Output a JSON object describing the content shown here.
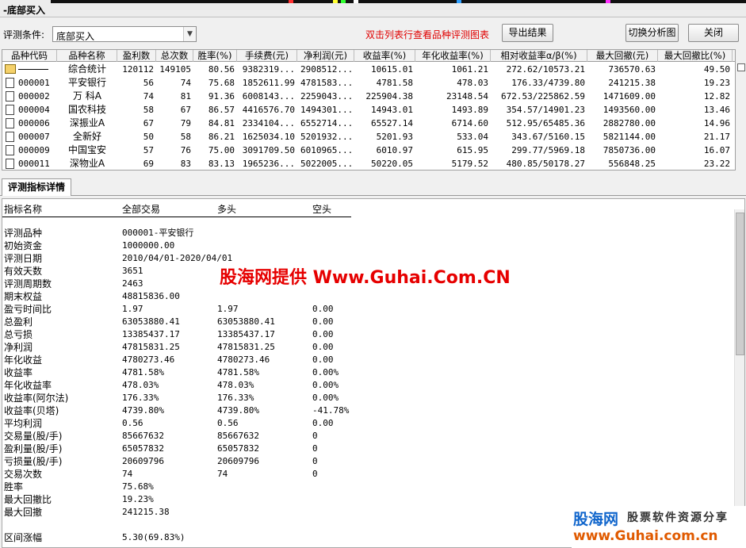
{
  "window": {
    "title": "-底部买入"
  },
  "condition": {
    "label": "评测条件:",
    "value": "底部买入",
    "hint": "双击列表行查看品种评测图表",
    "export_label": "导出结果",
    "switch_label": "切换分析图",
    "close_label": "关闭"
  },
  "table": {
    "columns": [
      "品种代码",
      "品种名称",
      "盈利数",
      "总次数",
      "胜率(%)",
      "手续费(元)",
      "净利润(元)",
      "收益率(%)",
      "年化收益率(%)",
      "相对收益率α/β(%)",
      "最大回撤(元)",
      "最大回撤比(%)"
    ],
    "summary": [
      "",
      "综合统计",
      "120112",
      "149105",
      "80.56",
      "9382319...",
      "2908512...",
      "10615.01",
      "1061.21",
      "272.62/10573.21",
      "736570.63",
      "49.50"
    ],
    "rows": [
      [
        "000001",
        "平安银行",
        "56",
        "74",
        "75.68",
        "1852611.99",
        "4781583...",
        "4781.58",
        "478.03",
        "176.33/4739.80",
        "241215.38",
        "19.23"
      ],
      [
        "000002",
        "万 科A",
        "74",
        "81",
        "91.36",
        "6008143...",
        "2259043...",
        "225904.38",
        "23148.54",
        "672.53/225862.59",
        "1471609.00",
        "12.82"
      ],
      [
        "000004",
        "国农科技",
        "58",
        "67",
        "86.57",
        "4416576.70",
        "1494301...",
        "14943.01",
        "1493.89",
        "354.57/14901.23",
        "1493560.00",
        "13.46"
      ],
      [
        "000006",
        "深振业A",
        "67",
        "79",
        "84.81",
        "2334104...",
        "6552714...",
        "65527.14",
        "6714.60",
        "512.95/65485.36",
        "2882780.00",
        "14.96"
      ],
      [
        "000007",
        "全新好",
        "50",
        "58",
        "86.21",
        "1625034.10",
        "5201932...",
        "5201.93",
        "533.04",
        "343.67/5160.15",
        "5821144.00",
        "21.17"
      ],
      [
        "000009",
        "中国宝安",
        "57",
        "76",
        "75.00",
        "3091709.50",
        "6010965...",
        "6010.97",
        "615.95",
        "299.77/5969.18",
        "7850736.00",
        "16.07"
      ],
      [
        "000011",
        "深物业A",
        "69",
        "83",
        "83.13",
        "1965236...",
        "5022005...",
        "50220.05",
        "5179.52",
        "480.85/50178.27",
        "556848.25",
        "23.22"
      ]
    ]
  },
  "tabs": [
    {
      "label": "评测指标详情"
    }
  ],
  "detail": {
    "headers": [
      "指标名称",
      "全部交易",
      "多头",
      "空头"
    ],
    "rows": [
      [
        "评测品种",
        "000001-平安银行",
        "",
        ""
      ],
      [
        "初始资金",
        "1000000.00",
        "",
        ""
      ],
      [
        "评测日期",
        "2010/04/01-2020/04/01",
        "",
        ""
      ],
      [
        "有效天数",
        "3651",
        "",
        ""
      ],
      [
        "评测周期数",
        "2463",
        "",
        ""
      ],
      [
        "期末权益",
        "48815836.00",
        "",
        ""
      ],
      [
        "盈亏时间比",
        "1.97",
        "1.97",
        "0.00"
      ],
      [
        "总盈利",
        "63053880.41",
        "63053880.41",
        "0.00"
      ],
      [
        "总亏损",
        "13385437.17",
        "13385437.17",
        "0.00"
      ],
      [
        "净利润",
        "47815831.25",
        "47815831.25",
        "0.00"
      ],
      [
        "年化收益",
        "4780273.46",
        "4780273.46",
        "0.00"
      ],
      [
        "收益率",
        "4781.58%",
        "4781.58%",
        "0.00%"
      ],
      [
        "年化收益率",
        "478.03%",
        "478.03%",
        "0.00%"
      ],
      [
        "收益率(阿尔法)",
        "176.33%",
        "176.33%",
        "0.00%"
      ],
      [
        "收益率(贝塔)",
        "4739.80%",
        "4739.80%",
        "-41.78%"
      ],
      [
        "平均利润",
        "0.56",
        "0.56",
        "0.00"
      ],
      [
        "交易量(股/手)",
        "85667632",
        "85667632",
        "0"
      ],
      [
        "盈利量(股/手)",
        "65057832",
        "65057832",
        "0"
      ],
      [
        "亏损量(股/手)",
        "20609796",
        "20609796",
        "0"
      ],
      [
        "交易次数",
        "74",
        "74",
        "0"
      ],
      [
        "胜率",
        "75.68%",
        "",
        ""
      ],
      [
        "最大回撤比",
        "19.23%",
        "",
        ""
      ],
      [
        "最大回撤",
        "241215.38",
        "",
        ""
      ],
      [
        "",
        "",
        "",
        ""
      ],
      [
        "区间涨幅",
        "5.30(69.83%)",
        "",
        ""
      ]
    ]
  },
  "watermark": "股海网提供 Www.Guhai.Com.CN",
  "brand": {
    "name": "股海网",
    "tagline": "股票软件资源分享",
    "url": "www.Guhai.com.cn"
  }
}
